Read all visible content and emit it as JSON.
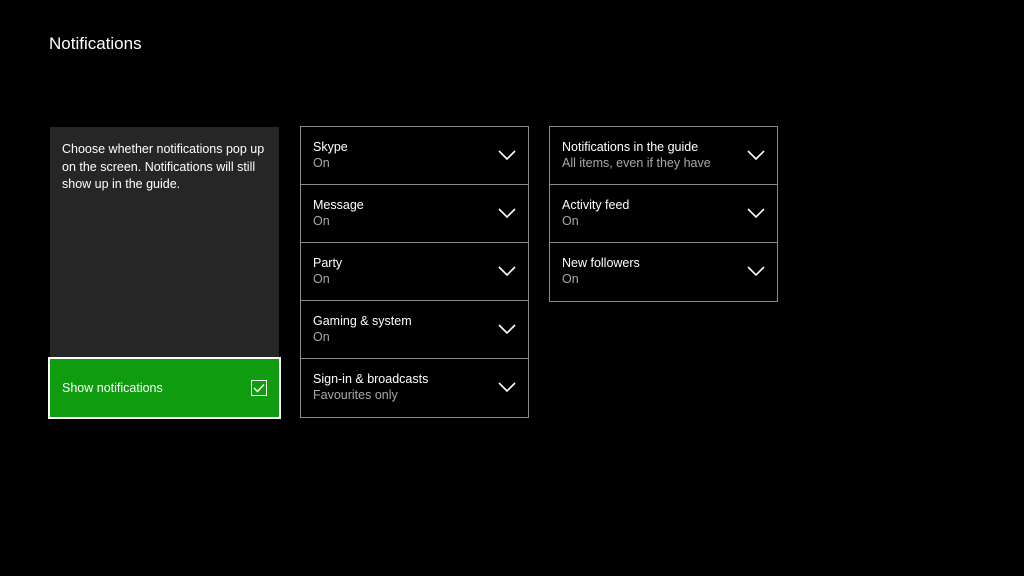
{
  "page": {
    "title": "Notifications"
  },
  "info_panel": {
    "description": "Choose whether notifications pop up on the screen. Notifications will still show up in the guide."
  },
  "toggle": {
    "label": "Show notifications",
    "checked": true,
    "accent_color": "#0f9d0f"
  },
  "column1": {
    "items": [
      {
        "label": "Skype",
        "value": "On"
      },
      {
        "label": "Message",
        "value": "On"
      },
      {
        "label": "Party",
        "value": "On"
      },
      {
        "label": "Gaming & system",
        "value": "On"
      },
      {
        "label": "Sign-in & broadcasts",
        "value": "Favourites only"
      }
    ]
  },
  "column2": {
    "items": [
      {
        "label": "Notifications in the guide",
        "value": "All items, even if they have"
      },
      {
        "label": "Activity feed",
        "value": "On"
      },
      {
        "label": "New followers",
        "value": "On"
      }
    ]
  },
  "icons": {
    "dropdown": "chevron-down-icon",
    "check": "checkmark-icon"
  }
}
